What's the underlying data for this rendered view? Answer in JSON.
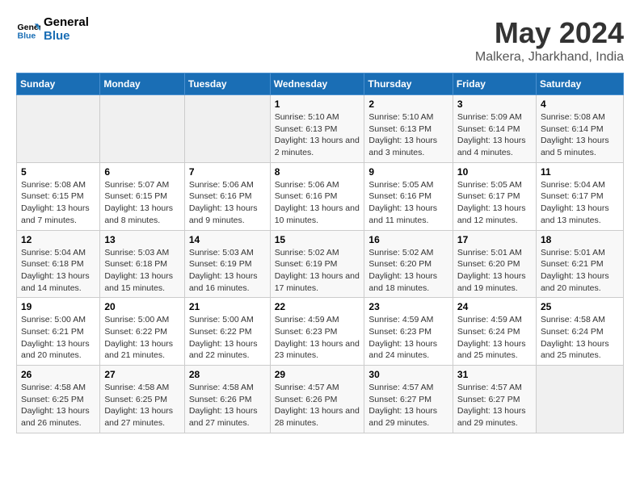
{
  "logo": {
    "text_general": "General",
    "text_blue": "Blue"
  },
  "title": "May 2024",
  "subtitle": "Malkera, Jharkhand, India",
  "days_of_week": [
    "Sunday",
    "Monday",
    "Tuesday",
    "Wednesday",
    "Thursday",
    "Friday",
    "Saturday"
  ],
  "weeks": [
    [
      {
        "day": "",
        "sunrise": "",
        "sunset": "",
        "daylight": ""
      },
      {
        "day": "",
        "sunrise": "",
        "sunset": "",
        "daylight": ""
      },
      {
        "day": "",
        "sunrise": "",
        "sunset": "",
        "daylight": ""
      },
      {
        "day": "1",
        "sunrise": "Sunrise: 5:10 AM",
        "sunset": "Sunset: 6:13 PM",
        "daylight": "Daylight: 13 hours and 2 minutes."
      },
      {
        "day": "2",
        "sunrise": "Sunrise: 5:10 AM",
        "sunset": "Sunset: 6:13 PM",
        "daylight": "Daylight: 13 hours and 3 minutes."
      },
      {
        "day": "3",
        "sunrise": "Sunrise: 5:09 AM",
        "sunset": "Sunset: 6:14 PM",
        "daylight": "Daylight: 13 hours and 4 minutes."
      },
      {
        "day": "4",
        "sunrise": "Sunrise: 5:08 AM",
        "sunset": "Sunset: 6:14 PM",
        "daylight": "Daylight: 13 hours and 5 minutes."
      }
    ],
    [
      {
        "day": "5",
        "sunrise": "Sunrise: 5:08 AM",
        "sunset": "Sunset: 6:15 PM",
        "daylight": "Daylight: 13 hours and 7 minutes."
      },
      {
        "day": "6",
        "sunrise": "Sunrise: 5:07 AM",
        "sunset": "Sunset: 6:15 PM",
        "daylight": "Daylight: 13 hours and 8 minutes."
      },
      {
        "day": "7",
        "sunrise": "Sunrise: 5:06 AM",
        "sunset": "Sunset: 6:16 PM",
        "daylight": "Daylight: 13 hours and 9 minutes."
      },
      {
        "day": "8",
        "sunrise": "Sunrise: 5:06 AM",
        "sunset": "Sunset: 6:16 PM",
        "daylight": "Daylight: 13 hours and 10 minutes."
      },
      {
        "day": "9",
        "sunrise": "Sunrise: 5:05 AM",
        "sunset": "Sunset: 6:16 PM",
        "daylight": "Daylight: 13 hours and 11 minutes."
      },
      {
        "day": "10",
        "sunrise": "Sunrise: 5:05 AM",
        "sunset": "Sunset: 6:17 PM",
        "daylight": "Daylight: 13 hours and 12 minutes."
      },
      {
        "day": "11",
        "sunrise": "Sunrise: 5:04 AM",
        "sunset": "Sunset: 6:17 PM",
        "daylight": "Daylight: 13 hours and 13 minutes."
      }
    ],
    [
      {
        "day": "12",
        "sunrise": "Sunrise: 5:04 AM",
        "sunset": "Sunset: 6:18 PM",
        "daylight": "Daylight: 13 hours and 14 minutes."
      },
      {
        "day": "13",
        "sunrise": "Sunrise: 5:03 AM",
        "sunset": "Sunset: 6:18 PM",
        "daylight": "Daylight: 13 hours and 15 minutes."
      },
      {
        "day": "14",
        "sunrise": "Sunrise: 5:03 AM",
        "sunset": "Sunset: 6:19 PM",
        "daylight": "Daylight: 13 hours and 16 minutes."
      },
      {
        "day": "15",
        "sunrise": "Sunrise: 5:02 AM",
        "sunset": "Sunset: 6:19 PM",
        "daylight": "Daylight: 13 hours and 17 minutes."
      },
      {
        "day": "16",
        "sunrise": "Sunrise: 5:02 AM",
        "sunset": "Sunset: 6:20 PM",
        "daylight": "Daylight: 13 hours and 18 minutes."
      },
      {
        "day": "17",
        "sunrise": "Sunrise: 5:01 AM",
        "sunset": "Sunset: 6:20 PM",
        "daylight": "Daylight: 13 hours and 19 minutes."
      },
      {
        "day": "18",
        "sunrise": "Sunrise: 5:01 AM",
        "sunset": "Sunset: 6:21 PM",
        "daylight": "Daylight: 13 hours and 20 minutes."
      }
    ],
    [
      {
        "day": "19",
        "sunrise": "Sunrise: 5:00 AM",
        "sunset": "Sunset: 6:21 PM",
        "daylight": "Daylight: 13 hours and 20 minutes."
      },
      {
        "day": "20",
        "sunrise": "Sunrise: 5:00 AM",
        "sunset": "Sunset: 6:22 PM",
        "daylight": "Daylight: 13 hours and 21 minutes."
      },
      {
        "day": "21",
        "sunrise": "Sunrise: 5:00 AM",
        "sunset": "Sunset: 6:22 PM",
        "daylight": "Daylight: 13 hours and 22 minutes."
      },
      {
        "day": "22",
        "sunrise": "Sunrise: 4:59 AM",
        "sunset": "Sunset: 6:23 PM",
        "daylight": "Daylight: 13 hours and 23 minutes."
      },
      {
        "day": "23",
        "sunrise": "Sunrise: 4:59 AM",
        "sunset": "Sunset: 6:23 PM",
        "daylight": "Daylight: 13 hours and 24 minutes."
      },
      {
        "day": "24",
        "sunrise": "Sunrise: 4:59 AM",
        "sunset": "Sunset: 6:24 PM",
        "daylight": "Daylight: 13 hours and 25 minutes."
      },
      {
        "day": "25",
        "sunrise": "Sunrise: 4:58 AM",
        "sunset": "Sunset: 6:24 PM",
        "daylight": "Daylight: 13 hours and 25 minutes."
      }
    ],
    [
      {
        "day": "26",
        "sunrise": "Sunrise: 4:58 AM",
        "sunset": "Sunset: 6:25 PM",
        "daylight": "Daylight: 13 hours and 26 minutes."
      },
      {
        "day": "27",
        "sunrise": "Sunrise: 4:58 AM",
        "sunset": "Sunset: 6:25 PM",
        "daylight": "Daylight: 13 hours and 27 minutes."
      },
      {
        "day": "28",
        "sunrise": "Sunrise: 4:58 AM",
        "sunset": "Sunset: 6:26 PM",
        "daylight": "Daylight: 13 hours and 27 minutes."
      },
      {
        "day": "29",
        "sunrise": "Sunrise: 4:57 AM",
        "sunset": "Sunset: 6:26 PM",
        "daylight": "Daylight: 13 hours and 28 minutes."
      },
      {
        "day": "30",
        "sunrise": "Sunrise: 4:57 AM",
        "sunset": "Sunset: 6:27 PM",
        "daylight": "Daylight: 13 hours and 29 minutes."
      },
      {
        "day": "31",
        "sunrise": "Sunrise: 4:57 AM",
        "sunset": "Sunset: 6:27 PM",
        "daylight": "Daylight: 13 hours and 29 minutes."
      },
      {
        "day": "",
        "sunrise": "",
        "sunset": "",
        "daylight": ""
      }
    ]
  ]
}
